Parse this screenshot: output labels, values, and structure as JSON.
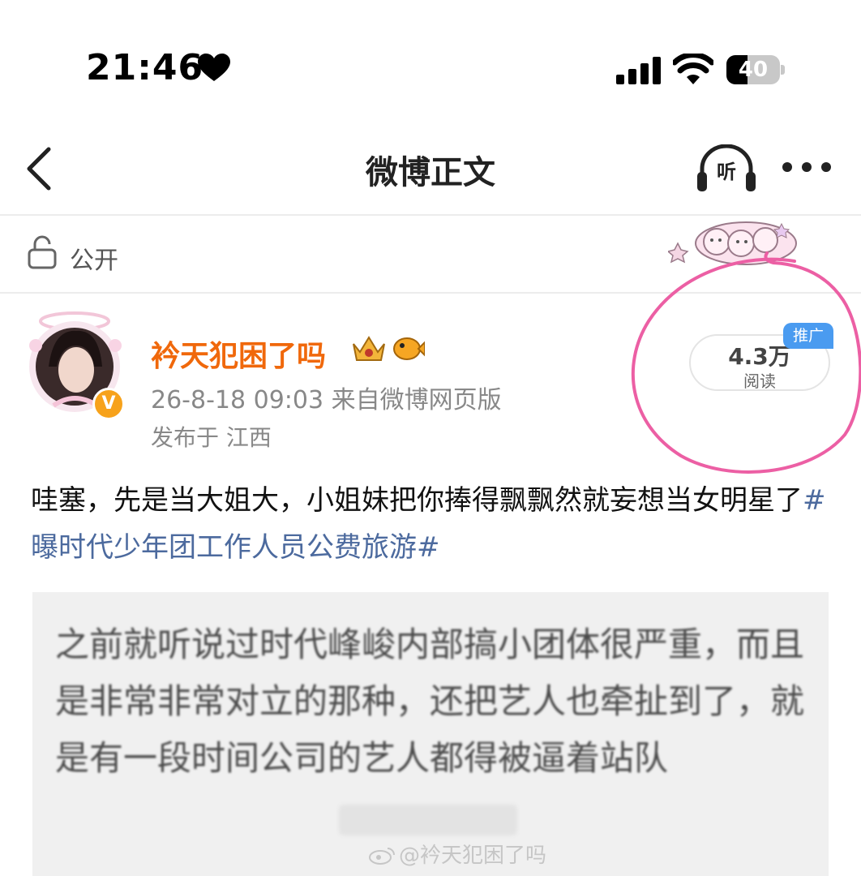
{
  "status_bar": {
    "time": "21:46",
    "battery_level": "40",
    "battery_fraction": 0.4
  },
  "nav": {
    "title": "微博正文",
    "listen_label": "听"
  },
  "visibility": {
    "label": "公开"
  },
  "post": {
    "username": "衿天犯困了吗",
    "verified_symbol": "V",
    "meta": "26-8-18 09:03  来自微博网页版",
    "location": "发布于 江西",
    "read_count": "4.3万",
    "read_label": "阅读",
    "promo_tag": "推广",
    "body_text": "哇塞，先是当大姐大，小姐妹把你捧得飘飘然就妄想当女明星了",
    "hashtag": "#曝时代少年团工作人员公费旅游#"
  },
  "embedded_image": {
    "text": "之前就听说过时代峰峻内部搞小团体很严重，而且是非常非常对立的那种，还把艺人也牵扯到了，就是有一段时间公司的艺人都得被逼着站队",
    "watermark": "@衿天犯困了吗"
  },
  "colors": {
    "username": "#f0680b",
    "hashtag": "#4c6a9e",
    "annotation": "#ec5fa4",
    "promo": "#4a9bf0"
  },
  "icons": [
    "heart-icon",
    "signal-icon",
    "wifi-icon",
    "battery-icon",
    "back-icon",
    "headphones-icon",
    "more-icon",
    "lock-icon",
    "crown-icon",
    "fish-icon",
    "weibo-logo-icon"
  ]
}
